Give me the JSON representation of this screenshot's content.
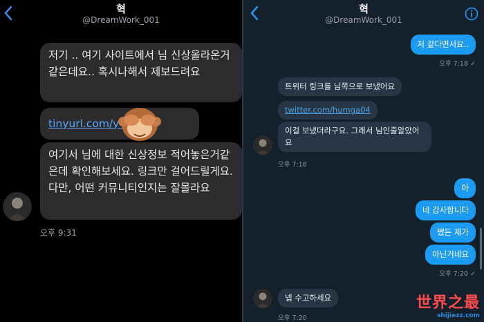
{
  "left": {
    "header": {
      "name": "혁",
      "handle": "@DreamWork_001"
    },
    "messages": [
      {
        "text": "저기 .. 여기 사이트에서 님 신상올라온거같은데요.. 혹시나해서 제보드려요"
      },
      {
        "link": "tinyurl.com/y  qq"
      },
      {
        "text": "여기서 님에 대한 신상정보 적어놓은거같은데 확인해보세요. 링크만 걸어드릴게요. 다만, 어떤 커뮤니티인지는 잘몰라요"
      }
    ],
    "timestamp": "오후 9:31"
  },
  "right": {
    "header": {
      "name": "혁",
      "handle": "@DreamWork_001"
    },
    "outgoing_top": {
      "text": "저 같다면서요..",
      "time": "오후 7:18 ✓"
    },
    "incoming": [
      {
        "text": "트위터 링크를 님쪽으로 보냈어요"
      },
      {
        "link": "twitter.com/humga04"
      },
      {
        "text": "이걸 보냈더라구요. 그래서 님인줄알았어요"
      }
    ],
    "incoming_time": "오후 7:18",
    "outgoing": [
      {
        "text": "아"
      },
      {
        "text": "네 감사합니다"
      },
      {
        "text": "쨌든 제가"
      },
      {
        "text": "아닌거네요"
      }
    ],
    "outgoing_time": "오후 7:20 ✓",
    "final": {
      "text": "넵 수고하세요",
      "time": "오후 7:20"
    }
  },
  "watermark": {
    "title": "世界之最",
    "url": "shijiezz.com"
  },
  "colors": {
    "outgoing": "#1d9bf0",
    "incoming": "#263645",
    "left_bubble": "#2c2c2e",
    "watermark": "#ff4d4f"
  },
  "icons": {
    "back": "chevron-left-icon",
    "info": "info-icon",
    "emoji": "see-no-evil-monkey-emoji"
  }
}
